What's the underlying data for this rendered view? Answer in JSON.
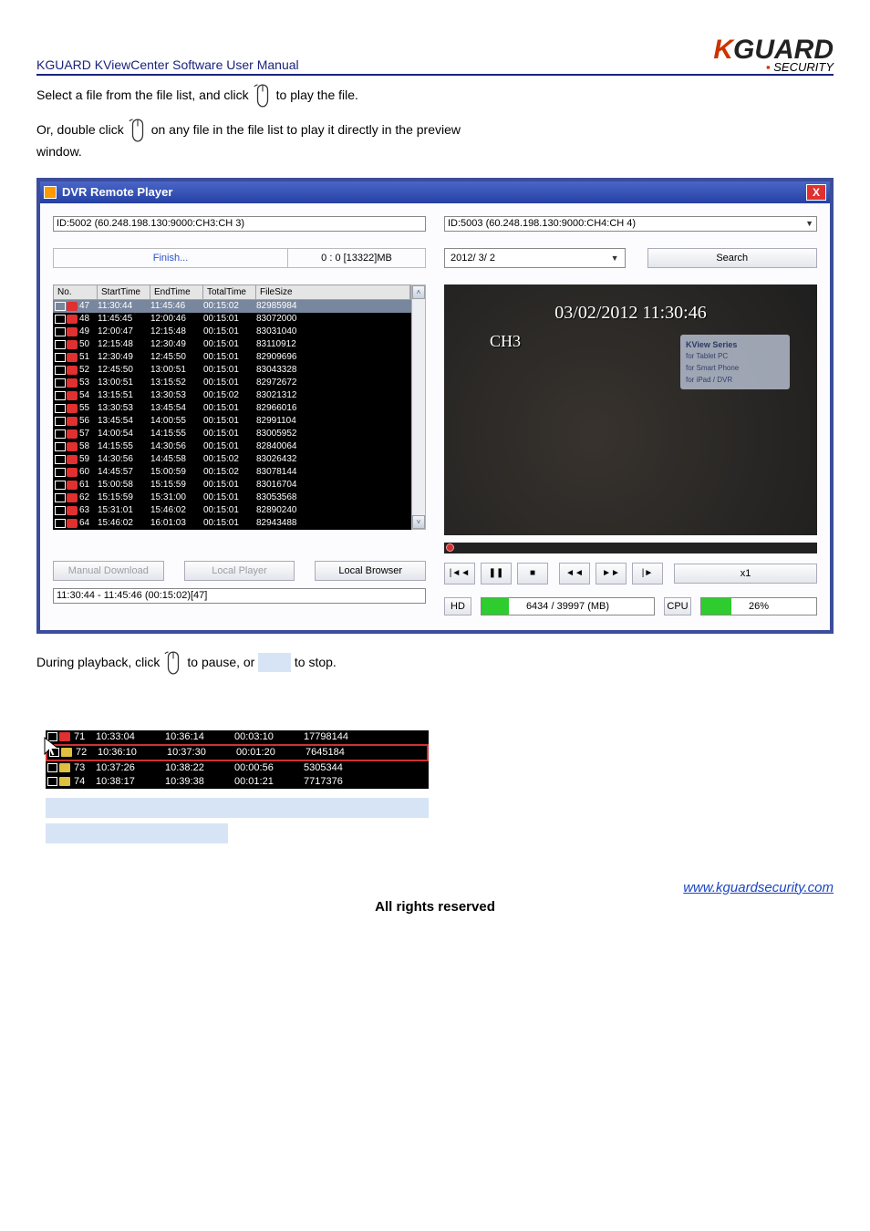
{
  "doc": {
    "title": "KGUARD KViewCenter Software User Manual",
    "brand_k": "K",
    "brand_guard": "GUARD",
    "brand_sub": "SECURITY",
    "footer_link": "www.kguardsecurity.com",
    "footer_center": "All rights reserved"
  },
  "steps": {
    "s1a": "Select a file from the file list, and click",
    "s1b": "to play the file.",
    "s2a": "Or, double click",
    "s2b": "on any file in the file list to play it directly in the preview",
    "s2c": "window."
  },
  "dvr": {
    "title": "DVR Remote Player",
    "close": "X",
    "left_id": "ID:5002 (60.248.198.130:9000:CH3:CH 3)",
    "finish": "Finish...",
    "finish_stat": "0 : 0 [13322]MB",
    "cols": {
      "no": "No.",
      "st": "StartTime",
      "et": "EndTime",
      "tt": "TotalTime",
      "fs": "FileSize"
    },
    "rows": [
      {
        "no": "47",
        "st": "11:30:44",
        "et": "11:45:46",
        "tt": "00:15:02",
        "fs": "82985984",
        "sel": true
      },
      {
        "no": "48",
        "st": "11:45:45",
        "et": "12:00:46",
        "tt": "00:15:01",
        "fs": "83072000"
      },
      {
        "no": "49",
        "st": "12:00:47",
        "et": "12:15:48",
        "tt": "00:15:01",
        "fs": "83031040"
      },
      {
        "no": "50",
        "st": "12:15:48",
        "et": "12:30:49",
        "tt": "00:15:01",
        "fs": "83110912"
      },
      {
        "no": "51",
        "st": "12:30:49",
        "et": "12:45:50",
        "tt": "00:15:01",
        "fs": "82909696"
      },
      {
        "no": "52",
        "st": "12:45:50",
        "et": "13:00:51",
        "tt": "00:15:01",
        "fs": "83043328"
      },
      {
        "no": "53",
        "st": "13:00:51",
        "et": "13:15:52",
        "tt": "00:15:01",
        "fs": "82972672"
      },
      {
        "no": "54",
        "st": "13:15:51",
        "et": "13:30:53",
        "tt": "00:15:02",
        "fs": "83021312"
      },
      {
        "no": "55",
        "st": "13:30:53",
        "et": "13:45:54",
        "tt": "00:15:01",
        "fs": "82966016"
      },
      {
        "no": "56",
        "st": "13:45:54",
        "et": "14:00:55",
        "tt": "00:15:01",
        "fs": "82991104"
      },
      {
        "no": "57",
        "st": "14:00:54",
        "et": "14:15:55",
        "tt": "00:15:01",
        "fs": "83005952"
      },
      {
        "no": "58",
        "st": "14:15:55",
        "et": "14:30:56",
        "tt": "00:15:01",
        "fs": "82840064"
      },
      {
        "no": "59",
        "st": "14:30:56",
        "et": "14:45:58",
        "tt": "00:15:02",
        "fs": "83026432"
      },
      {
        "no": "60",
        "st": "14:45:57",
        "et": "15:00:59",
        "tt": "00:15:02",
        "fs": "83078144"
      },
      {
        "no": "61",
        "st": "15:00:58",
        "et": "15:15:59",
        "tt": "00:15:01",
        "fs": "83016704"
      },
      {
        "no": "62",
        "st": "15:15:59",
        "et": "15:31:00",
        "tt": "00:15:01",
        "fs": "83053568"
      },
      {
        "no": "63",
        "st": "15:31:01",
        "et": "15:46:02",
        "tt": "00:15:01",
        "fs": "82890240"
      },
      {
        "no": "64",
        "st": "15:46:02",
        "et": "16:01:03",
        "tt": "00:15:01",
        "fs": "82943488"
      }
    ],
    "btn_manual": "Manual Download",
    "btn_local_player": "Local Player",
    "btn_local_browser": "Local Browser",
    "status_line": "11:30:44 - 11:45:46 (00:15:02)[47]",
    "right_id": "ID:5003 (60.248.198.130:9000:CH4:CH 4)",
    "date": "2012/ 3/ 2",
    "search": "Search",
    "preview_ts": "03/02/2012 11:30:46",
    "preview_ch": "CH3",
    "kv_title": "KView Series",
    "kv1": "for Tablet PC",
    "kv2": "for Smart Phone",
    "kv3": "for iPad / DVR",
    "speed": "x1",
    "hd_label": "HD",
    "hd_text": "6434 / 39997 (MB)",
    "hd_pct": 16,
    "cpu_label": "CPU",
    "cpu_text": "26%",
    "cpu_pct": 26
  },
  "post": {
    "s3a": "During playback, click",
    "s3b": "to pause, or",
    "s3c": "to stop."
  },
  "mini": {
    "rows": [
      {
        "no": "71",
        "st": "10:33:04",
        "et": "10:36:14",
        "tt": "00:03:10",
        "fs": "17798144",
        "ico": "r"
      },
      {
        "no": "72",
        "st": "10:36:10",
        "et": "10:37:30",
        "tt": "00:01:20",
        "fs": "7645184",
        "ico": "y",
        "boxed": true
      },
      {
        "no": "73",
        "st": "10:37:26",
        "et": "10:38:22",
        "tt": "00:00:56",
        "fs": "5305344",
        "ico": "y"
      },
      {
        "no": "74",
        "st": "10:38:17",
        "et": "10:39:38",
        "tt": "00:01:21",
        "fs": "7717376",
        "ico": "y"
      }
    ]
  }
}
